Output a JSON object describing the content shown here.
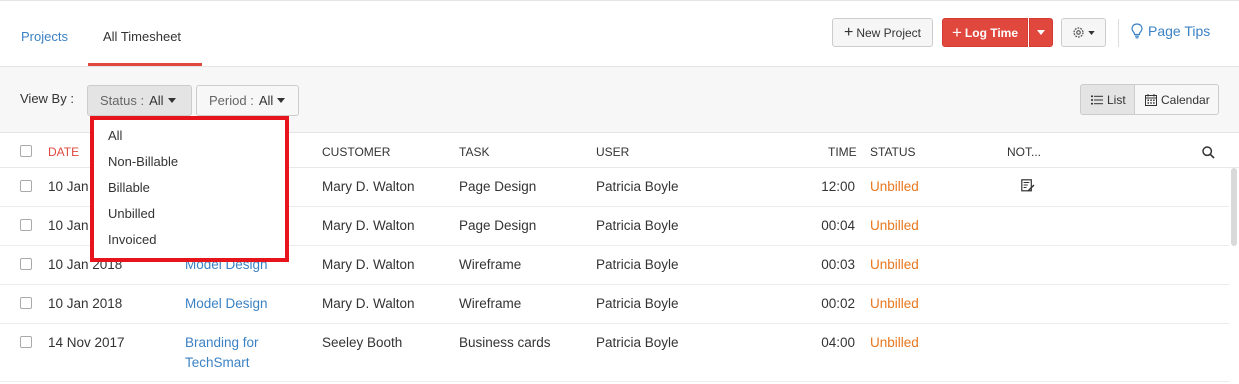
{
  "tabs": {
    "projects": "Projects",
    "all_timesheet": "All Timesheet"
  },
  "toolbar": {
    "new_project": "New Project",
    "log_time": "Log Time",
    "page_tips": "Page Tips"
  },
  "filters": {
    "view_by_label": "View By :",
    "status_label": "Status :",
    "status_value": "All",
    "period_label": "Period :",
    "period_value": "All",
    "list_label": "List",
    "calendar_label": "Calendar"
  },
  "columns": {
    "date": "DATE",
    "customer": "CUSTOMER",
    "task": "TASK",
    "user": "USER",
    "time": "TIME",
    "status": "STATUS",
    "notes": "NOT..."
  },
  "rows": [
    {
      "date": "10 Jan",
      "project": "",
      "customer": "Mary D. Walton",
      "task": "Page Design",
      "user": "Patricia Boyle",
      "time": "12:00",
      "status": "Unbilled",
      "has_note": true
    },
    {
      "date": "10 Jan",
      "project": "",
      "customer": "Mary D. Walton",
      "task": "Page Design",
      "user": "Patricia Boyle",
      "time": "00:04",
      "status": "Unbilled",
      "has_note": false
    },
    {
      "date": "10 Jan 2018",
      "project": "Model Design",
      "customer": "Mary D. Walton",
      "task": "Wireframe",
      "user": "Patricia Boyle",
      "time": "00:03",
      "status": "Unbilled",
      "has_note": false
    },
    {
      "date": "10 Jan 2018",
      "project": "Model Design",
      "customer": "Mary D. Walton",
      "task": "Wireframe",
      "user": "Patricia Boyle",
      "time": "00:02",
      "status": "Unbilled",
      "has_note": false
    },
    {
      "date": "14 Nov 2017",
      "project_line1": "Branding for",
      "project_line2": "TechSmart",
      "customer": "Seeley Booth",
      "task": "Business cards",
      "user": "Patricia Boyle",
      "time": "04:00",
      "status": "Unbilled",
      "has_note": false
    }
  ],
  "status_dropdown": {
    "options": [
      "All",
      "Non-Billable",
      "Billable",
      "Unbilled",
      "Invoiced"
    ]
  },
  "colors": {
    "accent_red": "#e0483e",
    "link_blue": "#3b82c4",
    "status_orange": "#e8771f",
    "highlight_box": "#e8141c"
  }
}
